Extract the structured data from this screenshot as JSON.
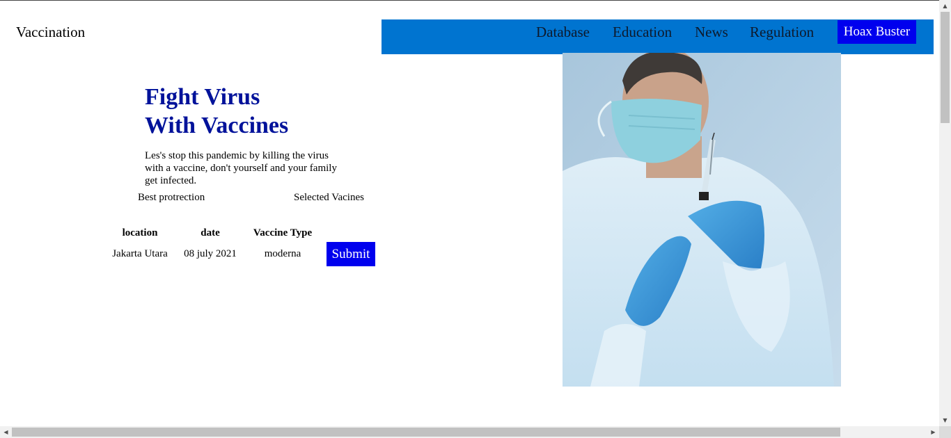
{
  "brand": "Vaccination",
  "nav": {
    "items": [
      "Database",
      "Education",
      "News",
      "Regulation"
    ],
    "cta": "Hoax Buster"
  },
  "hero": {
    "title_line1": "Fight Virus",
    "title_line2": "With Vaccines",
    "description": "Les's stop this pandemic by killing the virus with a vaccine, don't yourself and your family get infected.",
    "feature_left": "Best protrection",
    "feature_right": "Selected Vacines"
  },
  "booking": {
    "headers": [
      "location",
      "date",
      "Vaccine Type"
    ],
    "values": [
      "Jakarta Utara",
      "08 july 2021",
      "moderna"
    ],
    "submit_label": "Submit"
  },
  "colors": {
    "navbar": "#0074d0",
    "cta": "#0000ee",
    "headline": "#00129a"
  }
}
